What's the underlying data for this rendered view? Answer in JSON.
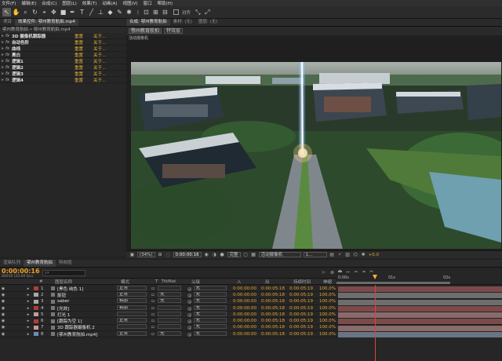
{
  "menu": [
    "文件(F)",
    "编辑(E)",
    "合成(C)",
    "图层(L)",
    "效果(T)",
    "动画(A)",
    "视图(V)",
    "窗口",
    "帮助(H)"
  ],
  "toolbar": {
    "align_label": "对齐"
  },
  "left_panel": {
    "tabs": [
      "项目",
      "效果控件: 鄂州教育航拍.mp4"
    ],
    "breadcrumb": "鄂州教育航拍 • 鄂州教育航拍.mp4",
    "effects": [
      {
        "name": "3D 摄像机跟踪器",
        "reset": "重置",
        "about": "关于..."
      },
      {
        "name": "自动色阶",
        "reset": "重置",
        "about": "关于..."
      },
      {
        "name": "曲线",
        "reset": "重置",
        "about": "关于..."
      },
      {
        "name": "黑白",
        "reset": "重置",
        "about": "关于..."
      },
      {
        "name": "逻辑1",
        "reset": "重置",
        "about": "关于..."
      },
      {
        "name": "逻辑2",
        "reset": "重置",
        "about": "关于..."
      },
      {
        "name": "逻辑3",
        "reset": "重置",
        "about": "关于..."
      },
      {
        "name": "逻辑4",
        "reset": "重置",
        "about": "关于..."
      }
    ]
  },
  "viewer": {
    "tabs": [
      "合成: 鄂州教育航拍",
      "素材: (无)",
      "图层: (无)"
    ],
    "subtabs": [
      "鄂州教育航拍",
      "特效层"
    ],
    "camera_label": "活动摄像机",
    "zoom": "(34%)",
    "timecode": "0:00:00:16",
    "resolution": "完整",
    "camera": "活动摄像机",
    "views": "1...",
    "exposure": "+0.0"
  },
  "timeline": {
    "tabs": [
      "渲染队列",
      "鄂州教育航拍",
      "特效层"
    ],
    "timecode": "0:00:00:16",
    "timecode_sub": "00016 (25.00 fps)",
    "search_placeholder": "ρ▾",
    "columns": {
      "name": "图层名称",
      "mode": "模式",
      "t": "T",
      "trkmat": "TrkMat",
      "parent": "父级",
      "in": "入",
      "out": "出",
      "duration": "持续时间",
      "stretch": "伸缩"
    },
    "ruler": [
      "0:00s",
      "01s",
      "02s"
    ],
    "layers": [
      {
        "num": "1",
        "name": "[黑色 纯色 1]",
        "color": "#b13c3c",
        "mode": "正常",
        "trk": "",
        "parent": "无",
        "in": "0:00:00:00",
        "out": "0:00:05:18",
        "dur": "0:00:05:19",
        "stretch": "100.0%",
        "bar": "#7b4a4a"
      },
      {
        "num": "2",
        "name": "旋钮",
        "color": "#a8a8a8",
        "mode": "正常",
        "trk": "无",
        "parent": "无",
        "in": "0:00:00:00",
        "out": "0:00:05:18",
        "dur": "0:00:05:19",
        "stretch": "100.0%",
        "bar": "#6e6e6e"
      },
      {
        "num": "3",
        "name": "saber",
        "color": "#a8a8a8",
        "mode": "相加",
        "trk": "无",
        "parent": "无",
        "in": "0:00:00:00",
        "out": "0:00:05:18",
        "dur": "0:00:05:19",
        "stretch": "100.0%",
        "bar": "#6e6e6e"
      },
      {
        "num": "4",
        "name": "[光效]",
        "color": "#b13c3c",
        "mode": "相加",
        "trk": "",
        "parent": "无",
        "in": "0:00:00:00",
        "out": "0:00:05:18",
        "dur": "0:00:05:19",
        "stretch": "100.0%",
        "bar": "#7b4a4a"
      },
      {
        "num": "5",
        "name": "灯光 1",
        "color": "#c89a9a",
        "mode": "",
        "trk": "",
        "parent": "无",
        "in": "0:00:00:00",
        "out": "0:00:05:18",
        "dur": "0:00:05:19",
        "stretch": "100.0%",
        "bar": "#8a6a6a"
      },
      {
        "num": "6",
        "name": "[跟踪为空 1]",
        "color": "#b13c3c",
        "mode": "正常",
        "trk": "",
        "parent": "无",
        "in": "0:00:00:00",
        "out": "0:00:05:18",
        "dur": "0:00:05:19",
        "stretch": "100.0%",
        "bar": "#7b4a4a"
      },
      {
        "num": "7",
        "name": "3D 跟踪器摄像机 2",
        "color": "#c89a9a",
        "mode": "",
        "trk": "",
        "parent": "无",
        "in": "0:00:00:00",
        "out": "0:00:05:18",
        "dur": "0:00:05:19",
        "stretch": "100.0%",
        "bar": "#8a6a6a"
      },
      {
        "num": "8",
        "name": "[鄂州教育航拍.mp4]",
        "color": "#6a8fb5",
        "mode": "正常",
        "trk": "无",
        "parent": "无",
        "in": "0:00:00:00",
        "out": "0:00:05:18",
        "dur": "0:00:05:19",
        "stretch": "100.0%",
        "bar": "#6a7584"
      }
    ]
  }
}
